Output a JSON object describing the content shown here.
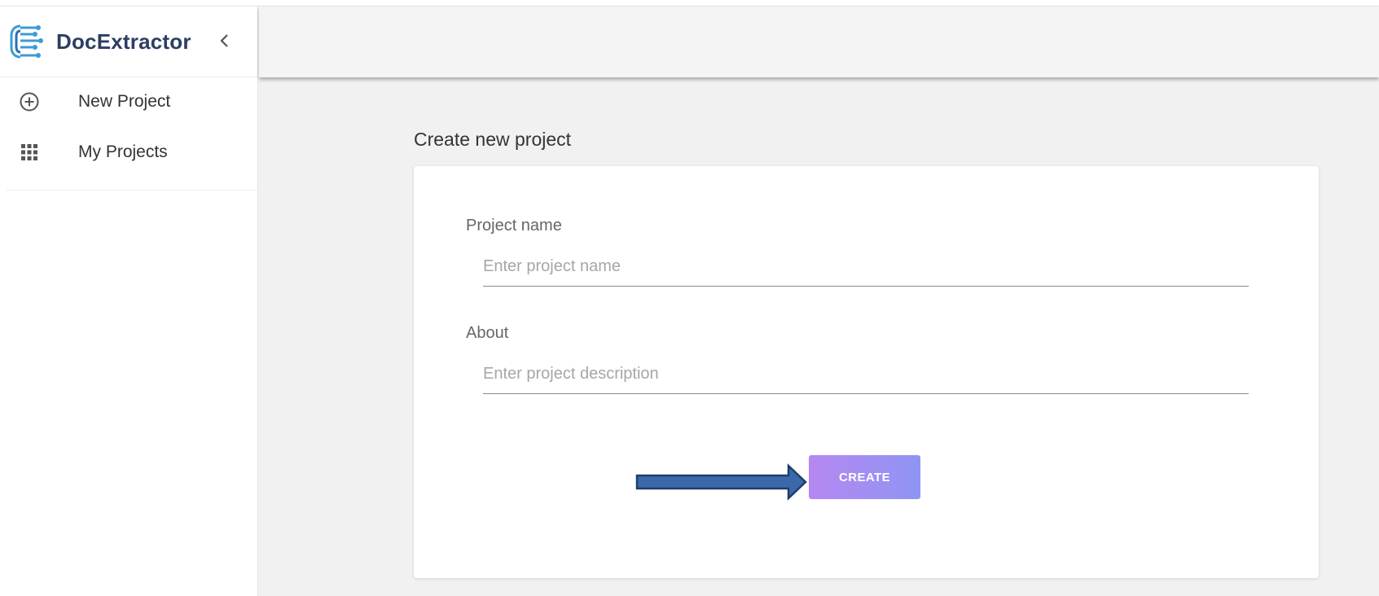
{
  "app": {
    "title": "DocExtractor"
  },
  "sidebar": {
    "items": [
      {
        "label": "New Project",
        "icon": "add-circle-icon"
      },
      {
        "label": "My Projects",
        "icon": "apps-grid-icon"
      }
    ]
  },
  "main": {
    "title": "Create new project",
    "form": {
      "name": {
        "label": "Project name",
        "placeholder": "Enter project name",
        "value": ""
      },
      "about": {
        "label": "About",
        "placeholder": "Enter project description",
        "value": ""
      },
      "submit_label": "CREATE"
    }
  },
  "colors": {
    "brand_text": "#2c3e63",
    "logo_blue": "#3d9bd6",
    "button_start": "#b687f2",
    "button_end": "#8e95f3",
    "arrow_fill": "#3a68a8",
    "arrow_stroke": "#1f3e6a",
    "background": "#f2f1f2"
  }
}
